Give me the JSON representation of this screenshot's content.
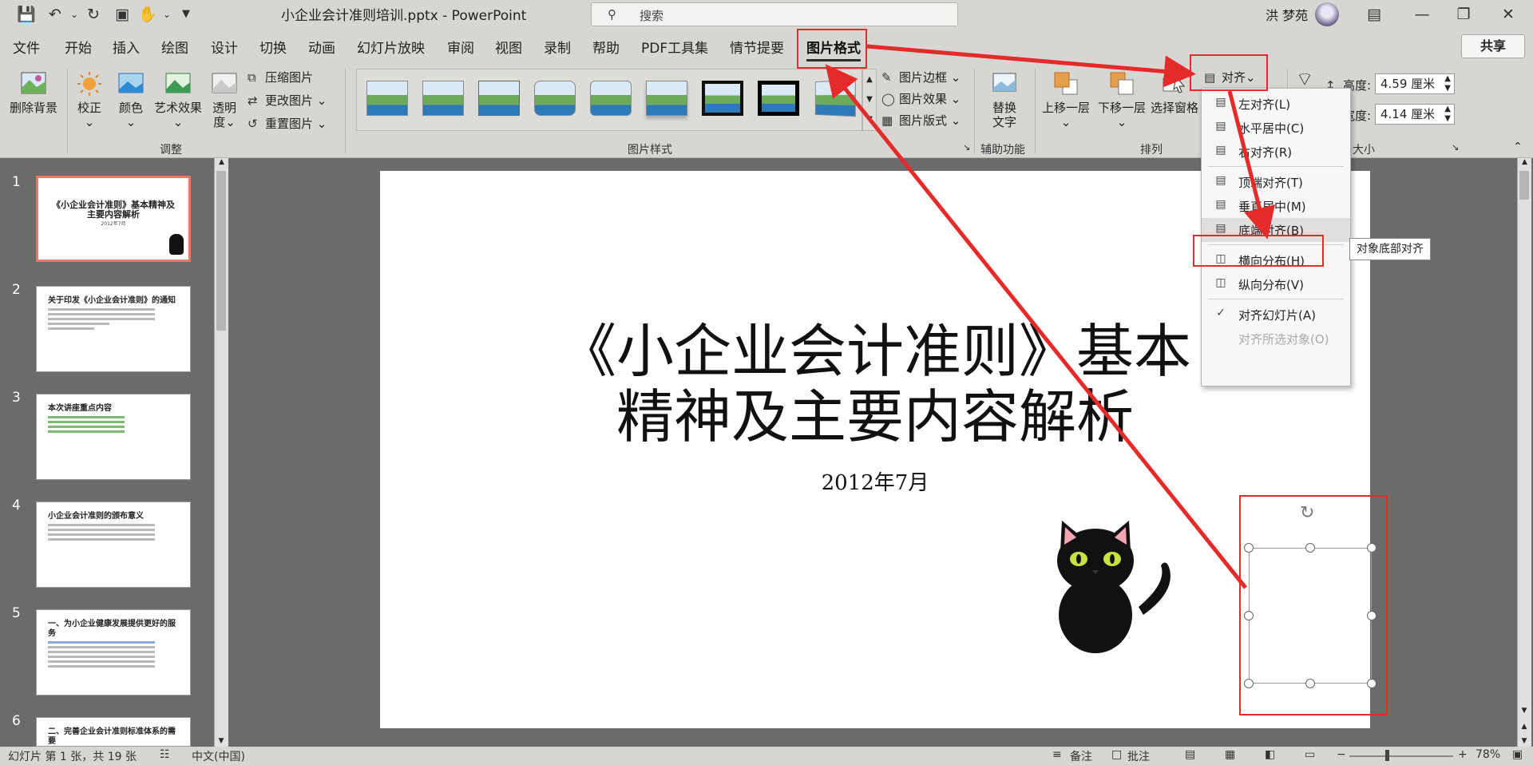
{
  "app": {
    "file_title": "小企业会计准则培训.pptx",
    "separator": "-",
    "app_name": "PowerPoint",
    "user": "洪 梦苑"
  },
  "search": {
    "placeholder": "搜索"
  },
  "menu": {
    "tabs": [
      "文件",
      "开始",
      "插入",
      "绘图",
      "设计",
      "切换",
      "动画",
      "幻灯片放映",
      "审阅",
      "视图",
      "录制",
      "帮助",
      "PDF工具集",
      "情节提要",
      "图片格式"
    ],
    "active": "图片格式",
    "share": "共享"
  },
  "ribbon": {
    "adjust": {
      "remove_bg": "删除背景",
      "correct": "校正",
      "color": "颜色",
      "artistic": "艺术效果",
      "transparency_1": "透明",
      "transparency_2": "度",
      "compress": "压缩图片",
      "change": "更改图片",
      "reset": "重置图片",
      "group": "调整"
    },
    "styles": {
      "group": "图片样式",
      "border": "图片边框",
      "effects": "图片效果",
      "layout": "图片版式"
    },
    "accessibility": {
      "alt_1": "替换",
      "alt_2": "文字",
      "group": "辅助功能"
    },
    "arrange": {
      "forward": "上移一层",
      "backward": "下移一层",
      "pane": "选择窗格",
      "align": "对齐",
      "group": "排列"
    },
    "size": {
      "height_label": "高度:",
      "height_value": "4.59 厘米",
      "width_label": "宽度:",
      "width_value": "4.14 厘米",
      "group": "大小"
    }
  },
  "align_menu": {
    "items": [
      {
        "label": "左对齐(L)",
        "icon": "align-left-icon"
      },
      {
        "label": "水平居中(C)",
        "icon": "align-center-icon"
      },
      {
        "label": "右对齐(R)",
        "icon": "align-right-icon"
      },
      {
        "label": "顶端对齐(T)",
        "icon": "align-top-icon"
      },
      {
        "label": "垂直居中(M)",
        "icon": "align-middle-icon"
      },
      {
        "label": "底端对齐(B)",
        "icon": "align-bottom-icon"
      },
      {
        "label": "横向分布(H)",
        "icon": "distribute-horizontal-icon"
      },
      {
        "label": "纵向分布(V)",
        "icon": "distribute-vertical-icon"
      },
      {
        "label": "对齐幻灯片(A)",
        "icon": "check-icon"
      },
      {
        "label": "对齐所选对象(O)",
        "icon": ""
      }
    ],
    "tooltip": "对象底部对齐"
  },
  "slides": [
    {
      "num": "1",
      "title": "《小企业会计准则》基本精神及主要内容解析",
      "sub": "2012年7月"
    },
    {
      "num": "2",
      "title": "关于印发《小企业会计准则》的通知"
    },
    {
      "num": "3",
      "title": "本次讲座重点内容"
    },
    {
      "num": "4",
      "title": "小企业会计准则的颁布意义"
    },
    {
      "num": "5",
      "title": "一、为小企业健康发展提供更好的服务"
    },
    {
      "num": "6",
      "title": "二、完善企业会计准则标准体系的需要"
    }
  ],
  "main_slide": {
    "title_line1": "《小企业会计准则》基本",
    "title_line2": "精神及主要内容解析",
    "date": "2012年7月"
  },
  "status": {
    "slide_info": "幻灯片 第 1 张，共 19 张",
    "language": "中文(中国)",
    "notes": "备注",
    "comments": "批注",
    "zoom": "78%"
  },
  "colors": {
    "annotation_red": "#e52a2a",
    "ribbon_bg": "#d8d6d3",
    "canvas_bg": "#6b6b6b"
  }
}
